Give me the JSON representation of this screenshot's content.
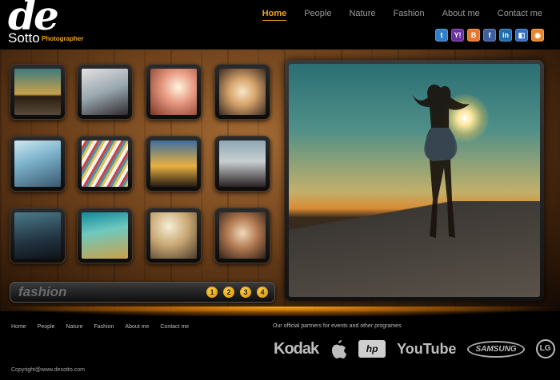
{
  "header": {
    "logo_mark": "de",
    "logo_name": "Sotto",
    "logo_sub": "Photographer"
  },
  "nav": {
    "items": [
      "Home",
      "People",
      "Nature",
      "Fashion",
      "About me",
      "Contact me"
    ],
    "active": "Home"
  },
  "social": {
    "icons": [
      {
        "name": "twitter-icon",
        "glyph": "t",
        "color": "#2f7fc9"
      },
      {
        "name": "yahoo-icon",
        "glyph": "Y!",
        "color": "#6a2ea0"
      },
      {
        "name": "blogger-icon",
        "glyph": "B",
        "color": "#e8772e"
      },
      {
        "name": "facebook-icon",
        "glyph": "f",
        "color": "#3b5fa0"
      },
      {
        "name": "linkedin-icon",
        "glyph": "in",
        "color": "#1f6fb0"
      },
      {
        "name": "windows-icon",
        "glyph": "◧",
        "color": "#2f6fc0"
      },
      {
        "name": "rss-icon",
        "glyph": "◉",
        "color": "#e8842a"
      }
    ]
  },
  "gallery": {
    "thumbs": [
      {
        "name": "thumb-1-1",
        "bg": "linear-gradient(180deg,#3d7a80 0%,#c9a24a 55%,#2a1d10 60%,#5a4a3a 100%)"
      },
      {
        "name": "thumb-1-2",
        "bg": "linear-gradient(160deg,#e3e1e0 0%,#9aa7b0 50%,#2f2a2d 100%)"
      },
      {
        "name": "thumb-1-3",
        "bg": "radial-gradient(circle at 60% 40%,#fff4e0 0%,#e89a82 40%,#7a3424 100%)"
      },
      {
        "name": "thumb-1-4",
        "bg": "radial-gradient(circle at 50% 50%,#f7e6c8 0%,#d7a46b 40%,#3a2a22 100%)"
      },
      {
        "name": "thumb-2-1",
        "bg": "linear-gradient(160deg,#cfe8f0 0%,#7fb6cf 40%,#3a5870 100%)"
      },
      {
        "name": "thumb-2-2",
        "bg": "repeating-linear-gradient(120deg,#f2f2f2 0 4px,#c44 4px 7px,#4a90b0 7px 10px,#e0c050 10px 13px)"
      },
      {
        "name": "thumb-2-3",
        "bg": "linear-gradient(180deg,#3a6fa0 0%,#e8b040 55%,#241a12 100%)"
      },
      {
        "name": "thumb-2-4",
        "bg": "linear-gradient(180deg,#8ea7b5 0%,#c9cfd0 45%,#2b2224 100%)"
      },
      {
        "name": "thumb-3-1",
        "bg": "linear-gradient(170deg,#4a7a8a 0%,#223240 60%,#0e1418 100%)"
      },
      {
        "name": "thumb-3-2",
        "bg": "linear-gradient(170deg,#0f8a9a 0%,#6ec8c0 40%,#c9a24a 100%)"
      },
      {
        "name": "thumb-3-3",
        "bg": "radial-gradient(circle at 40% 30%,#f6eed4 0%,#c9a874 45%,#4a3a2a 100%)"
      },
      {
        "name": "thumb-3-4",
        "bg": "radial-gradient(circle at 50% 45%,#f0d8b8 0%,#b07850 45%,#2e2018 100%)"
      }
    ],
    "category_label": "fashion",
    "pages": [
      "1",
      "2",
      "3",
      "4"
    ]
  },
  "footer": {
    "nav": [
      "Home",
      "People",
      "Nature",
      "Fashion",
      "About me",
      "Contact me"
    ],
    "partners_title": "Our official partners for events and other programes",
    "partners": {
      "kodak": "Kodak",
      "hp": "hp",
      "youtube": "YouTube",
      "samsung": "SAMSUNG",
      "lg": "LG"
    },
    "copyright": "Copyright@www.desotto.com"
  },
  "colors": {
    "accent": "#f3a21a"
  }
}
